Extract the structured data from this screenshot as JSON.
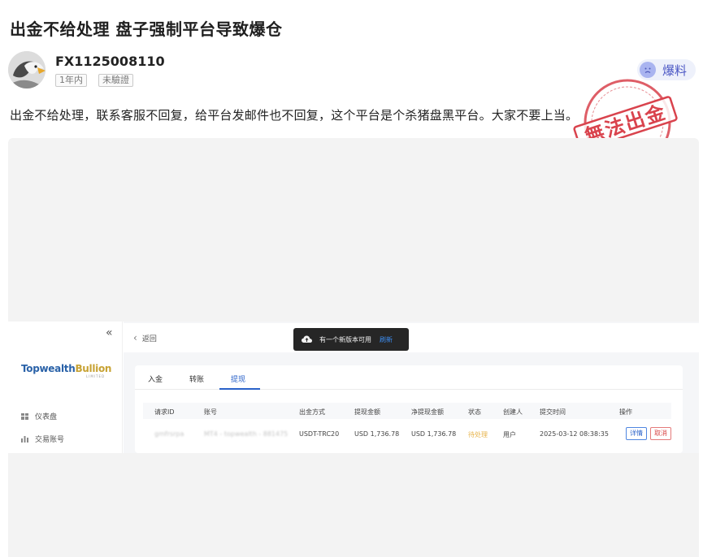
{
  "post": {
    "title": "出金不给处理 盘子强制平台导致爆仓",
    "username": "FX1125008110",
    "tags": [
      "1年内",
      "未驗證"
    ],
    "report_label": "爆料",
    "body": "出金不给处理，联系客服不回复，给平台发邮件也不回复，这个平台是个杀猪盘黑平台。大家不要上当。",
    "stamp_text": "無法出金"
  },
  "screenshot": {
    "logo_main": "Topwealth",
    "logo_accent": "Bullion",
    "logo_sub": "LIMITED",
    "collapse_icon": "«",
    "nav": [
      {
        "icon": "dashboard-icon",
        "label": "仪表盘"
      },
      {
        "icon": "bar-chart-icon",
        "label": "交易账号"
      }
    ],
    "back_label": "返回",
    "toast": {
      "text": "有一个新版本可用",
      "link": "刷新"
    },
    "tabs": [
      "入金",
      "转账",
      "提现"
    ],
    "active_tab": "提现",
    "table": {
      "headers": [
        "请求ID",
        "账号",
        "出金方式",
        "提现金额",
        "净提现金额",
        "状态",
        "创建人",
        "提交时间",
        "操作"
      ],
      "rows": [
        {
          "request_id": "gmfrsrpa",
          "account": "MT4 - topwealth - 881475",
          "method": "USDT-TRC20",
          "amount": "USD 1,736.78",
          "net_amount": "USD 1,736.78",
          "status": "待处理",
          "creator": "用户",
          "submitted": "2025-03-12 08:38:35",
          "action_detail": "详情",
          "action_cancel": "取消"
        }
      ]
    }
  },
  "colors": {
    "accent_blue": "#2a62c9",
    "report_purple": "#4b57c4",
    "stamp_red": "#d9434d",
    "status_orange": "#e7b34a"
  }
}
